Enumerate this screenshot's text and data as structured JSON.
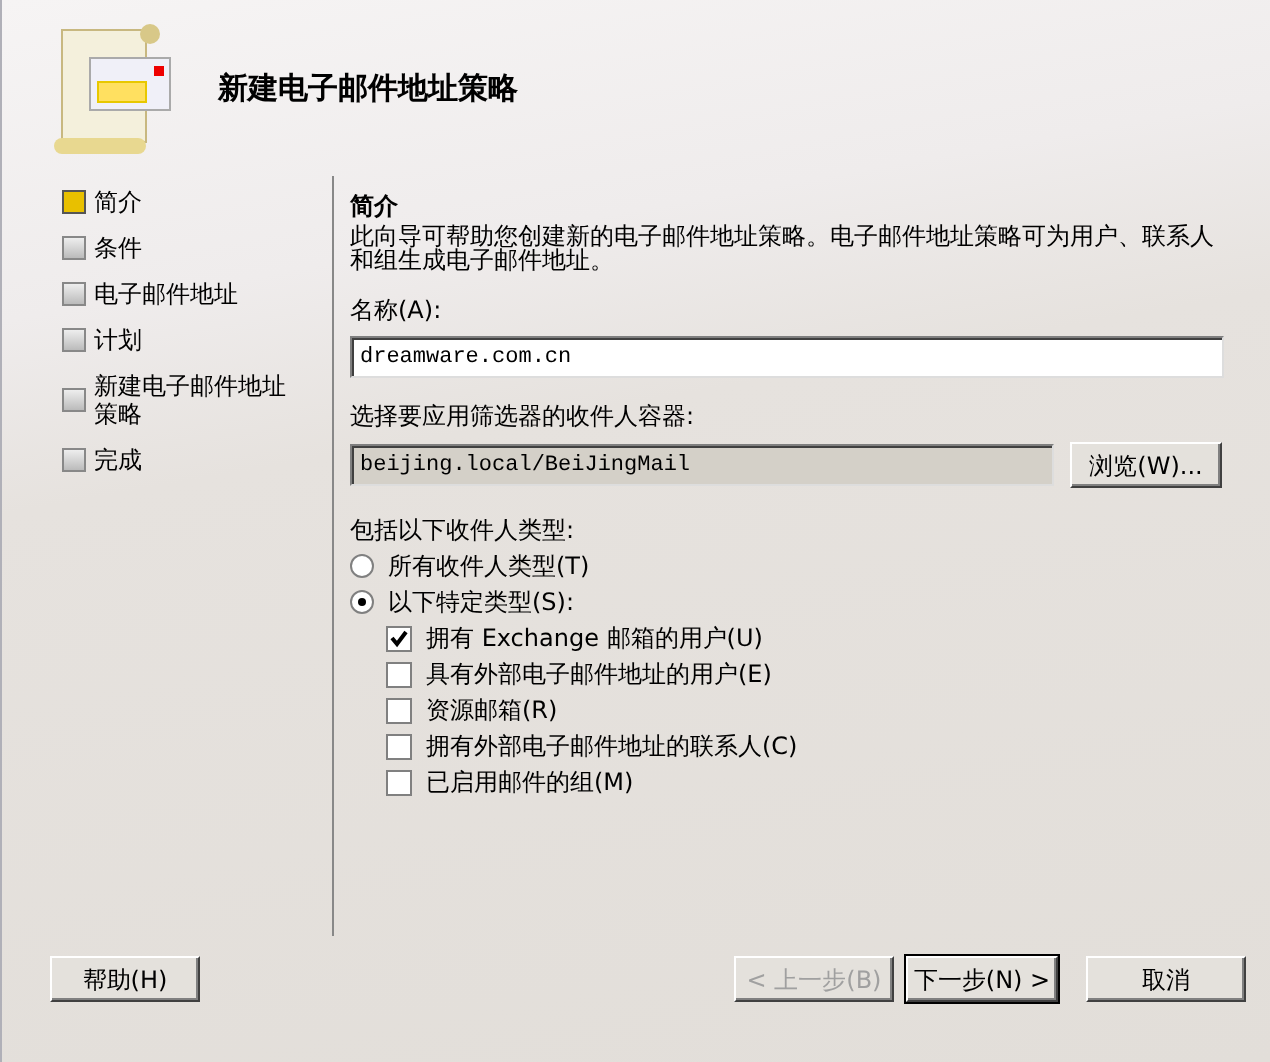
{
  "header": {
    "title": "新建电子邮件地址策略"
  },
  "steps": [
    {
      "label": "简介",
      "selected": true
    },
    {
      "label": "条件",
      "selected": false
    },
    {
      "label": "电子邮件地址",
      "selected": false
    },
    {
      "label": "计划",
      "selected": false
    },
    {
      "label": "新建电子邮件地址策略",
      "selected": false
    },
    {
      "label": "完成",
      "selected": false
    }
  ],
  "content": {
    "heading": "简介",
    "description": "此向导可帮助您创建新的电子邮件地址策略。电子邮件地址策略可为用户、联系人和组生成电子邮件地址。",
    "name_label": "名称(A):",
    "name_value": "dreamware.com.cn",
    "container_label": "选择要应用筛选器的收件人容器:",
    "container_value": "beijing.local/BeiJingMail",
    "browse_button": "浏览(W)...",
    "types_label": "包括以下收件人类型:",
    "radios": [
      {
        "label": "所有收件人类型(T)",
        "selected": false
      },
      {
        "label": "以下特定类型(S):",
        "selected": true
      }
    ],
    "checkboxes": [
      {
        "label": "拥有 Exchange 邮箱的用户(U)",
        "checked": true
      },
      {
        "label": "具有外部电子邮件地址的用户(E)",
        "checked": false
      },
      {
        "label": "资源邮箱(R)",
        "checked": false
      },
      {
        "label": "拥有外部电子邮件地址的联系人(C)",
        "checked": false
      },
      {
        "label": "已启用邮件的组(M)",
        "checked": false
      }
    ]
  },
  "buttons": [
    {
      "label": "帮助(H)",
      "kind": "help",
      "disabled": false
    },
    {
      "label": "< 上一步(B)",
      "kind": "nav",
      "disabled": true
    },
    {
      "label": "下一步(N) >",
      "kind": "default",
      "disabled": false
    },
    {
      "label": "取消",
      "kind": "nav",
      "disabled": false
    }
  ]
}
